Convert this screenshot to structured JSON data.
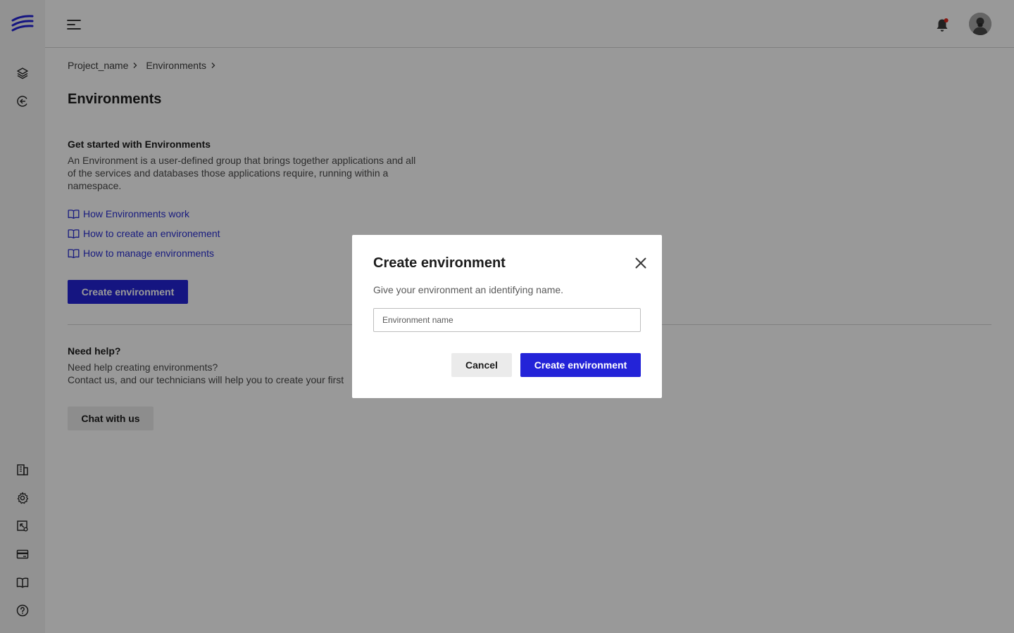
{
  "sidebar": {
    "logo_icon": "brand-logo-icon",
    "top_items": [
      {
        "icon": "layers-icon"
      },
      {
        "icon": "circle-arrow-left-icon"
      }
    ],
    "bottom_items": [
      {
        "icon": "building-icon"
      },
      {
        "icon": "gear-icon"
      },
      {
        "icon": "image-cursor-icon"
      },
      {
        "icon": "credit-card-icon"
      },
      {
        "icon": "book-icon"
      },
      {
        "icon": "question-icon"
      }
    ]
  },
  "topbar": {
    "menu_icon": "hamburger-menu-icon",
    "bell_icon": "bell-icon",
    "notification_color": "#e0261b"
  },
  "breadcrumb": {
    "items": [
      "Project_name",
      "Environments"
    ]
  },
  "page": {
    "title": "Environments"
  },
  "getting_started": {
    "title": "Get started with Environments",
    "description": "An Environment is a user-defined group that brings together applications and all of the services and databases those applications require, running within a namespace.",
    "links": [
      "How Environments work",
      "How to create an environement",
      "How to manage environments"
    ],
    "create_button": "Create environment"
  },
  "help": {
    "title": "Need help?",
    "line1": "Need help creating environments?",
    "line2": "Contact us, and our technicians will help you to create your first",
    "chat_button": "Chat with us"
  },
  "modal": {
    "title": "Create environment",
    "description": "Give your environment an identifying name.",
    "input_placeholder": "Environment name",
    "cancel_button": "Cancel",
    "create_button": "Create environment"
  },
  "colors": {
    "primary": "#2323d8",
    "link": "#2a2fd4",
    "overlay": "rgba(0,0,0,0.40)"
  }
}
